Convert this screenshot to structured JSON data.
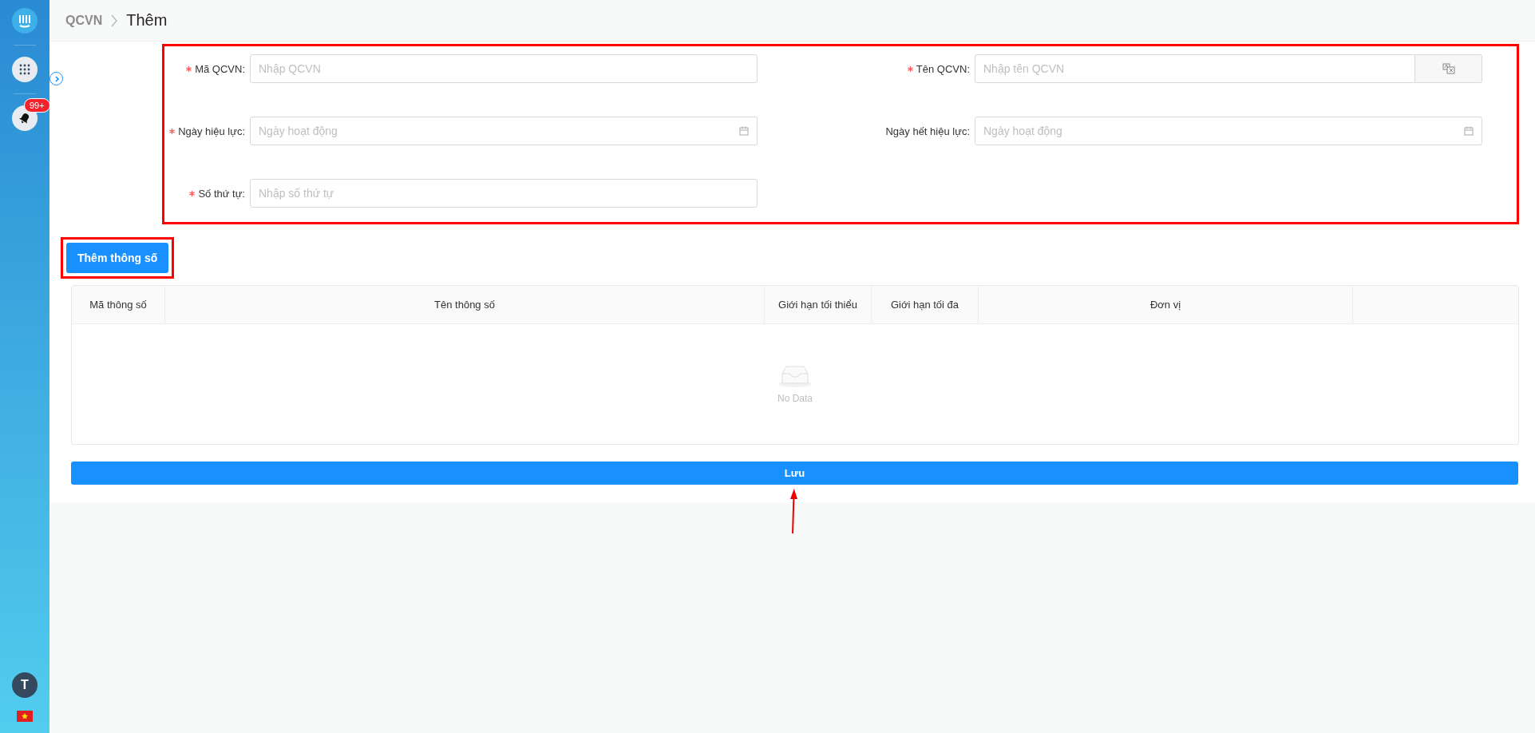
{
  "sidebar": {
    "notification_badge": "99+",
    "avatar_letter": "T"
  },
  "breadcrumb": {
    "parent": "QCVN",
    "current": "Thêm"
  },
  "form": {
    "fields": [
      {
        "label": "Mã QCVN:",
        "placeholder": "Nhập QCVN",
        "required": true,
        "kind": "text"
      },
      {
        "label": "Tên QCVN:",
        "placeholder": "Nhập tên QCVN",
        "required": true,
        "kind": "translate"
      },
      {
        "label": "Ngày hiệu lực:",
        "placeholder": "Ngày hoạt động",
        "required": true,
        "kind": "date"
      },
      {
        "label": "Ngày hết hiệu lực:",
        "placeholder": "Ngày hoạt động",
        "required": false,
        "kind": "date"
      },
      {
        "label": "Số thứ tự:",
        "placeholder": "Nhập số thứ tự",
        "required": true,
        "kind": "text"
      }
    ]
  },
  "add_button": "Thêm thông số",
  "table": {
    "columns": [
      "Mã thông số",
      "Tên thông số",
      "Giới hạn tối thiểu",
      "Giới hạn tối đa",
      "Đơn vị",
      ""
    ],
    "empty_text": "No Data"
  },
  "save_button": "Lưu"
}
